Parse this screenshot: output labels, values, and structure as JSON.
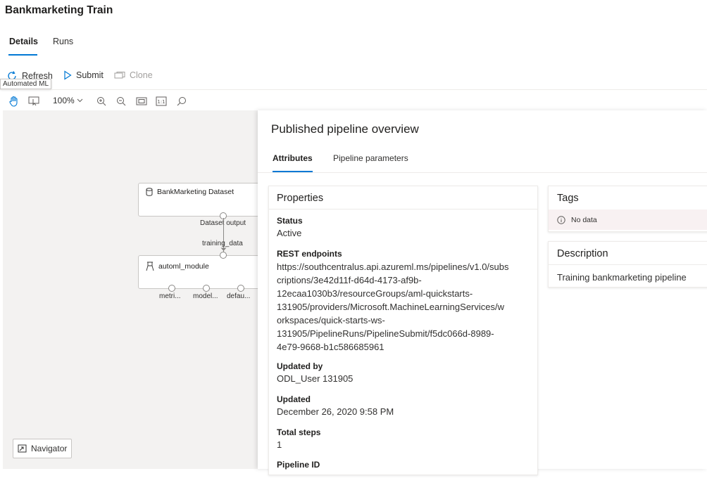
{
  "page_title": "Bankmarketing Train",
  "tabs": {
    "details": "Details",
    "runs": "Runs"
  },
  "commands": {
    "refresh": "Refresh",
    "submit": "Submit",
    "clone": "Clone"
  },
  "tooltip": "Automated ML",
  "toolbar": {
    "zoom": "100%"
  },
  "graph": {
    "dataset_node": {
      "label": "BankMarketing Dataset",
      "output_port": "Dataset output"
    },
    "edge_label": "training_data",
    "module_node": {
      "label": "automl_module",
      "ports": [
        "metri...",
        "model...",
        "defau..."
      ]
    }
  },
  "navigator": "Navigator",
  "panel": {
    "title": "Published pipeline overview",
    "tabs": {
      "attributes": "Attributes",
      "pipeline_parameters": "Pipeline parameters"
    },
    "properties": {
      "heading": "Properties",
      "status_label": "Status",
      "status_value": "Active",
      "rest_label": "REST endpoints",
      "rest_lines": [
        "https://southcentralus.api.azureml.ms/pipelines/v1.0/subs",
        "criptions/3e42d11f-d64d-4173-af9b-",
        "12ecaa1030b3/resourceGroups/aml-quickstarts-",
        "131905/providers/Microsoft.MachineLearningServices/w",
        "orkspaces/quick-starts-ws-",
        "131905/PipelineRuns/PipelineSubmit/f5dc066d-8989-",
        "4e79-9668-b1c586685961"
      ],
      "updated_by_label": "Updated by",
      "updated_by_value": "ODL_User 131905",
      "updated_label": "Updated",
      "updated_value": "December 26, 2020 9:58 PM",
      "total_steps_label": "Total steps",
      "total_steps_value": "1",
      "pipeline_id_label": "Pipeline ID"
    },
    "tags": {
      "heading": "Tags",
      "no_data": "No data"
    },
    "description": {
      "heading": "Description",
      "value": "Training bankmarketing pipeline"
    }
  }
}
